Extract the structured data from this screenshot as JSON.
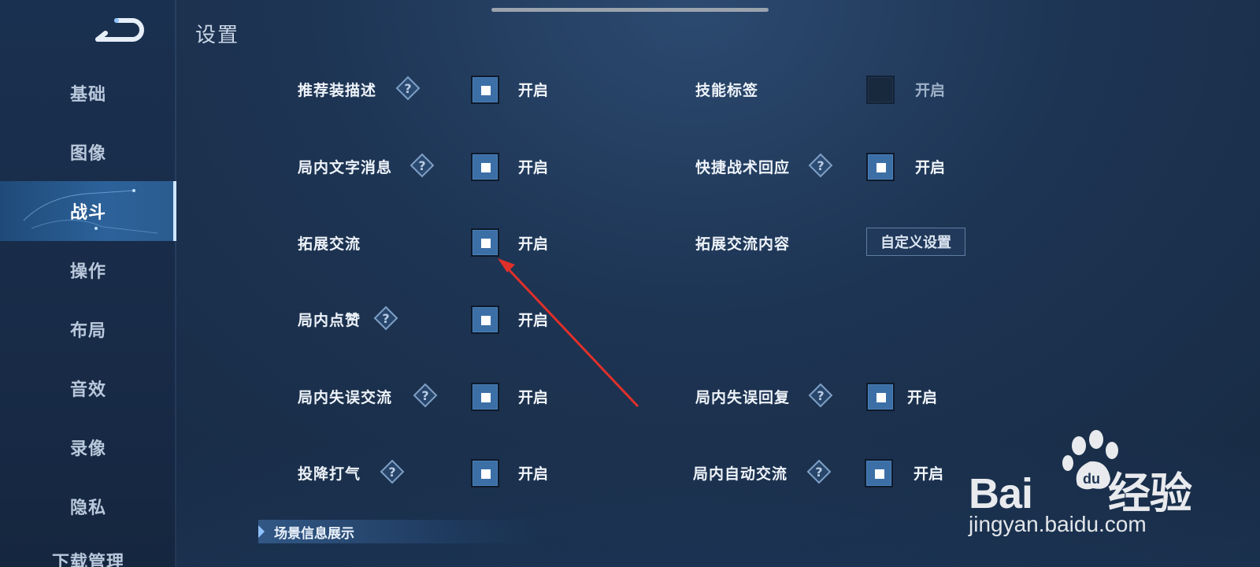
{
  "header": {
    "title": "设置"
  },
  "sidebar": {
    "items": [
      {
        "label": "基础"
      },
      {
        "label": "图像"
      },
      {
        "label": "战斗",
        "active": true
      },
      {
        "label": "操作"
      },
      {
        "label": "布局"
      },
      {
        "label": "音效"
      },
      {
        "label": "录像"
      },
      {
        "label": "隐私"
      },
      {
        "label": "下载管理"
      }
    ]
  },
  "settings": {
    "left": [
      {
        "label": "推荐装描述",
        "help": true,
        "checked": true,
        "state_text": "开启"
      },
      {
        "label": "局内文字消息",
        "help": true,
        "checked": true,
        "state_text": "开启"
      },
      {
        "label": "拓展交流",
        "help": false,
        "checked": true,
        "state_text": "开启"
      },
      {
        "label": "局内点赞",
        "help": true,
        "checked": true,
        "state_text": "开启"
      },
      {
        "label": "局内失误交流",
        "help": true,
        "checked": true,
        "state_text": "开启"
      },
      {
        "label": "投降打气",
        "help": true,
        "checked": true,
        "state_text": "开启"
      }
    ],
    "right": [
      {
        "label": "技能标签",
        "help": false,
        "checked": false,
        "state_text": "开启"
      },
      {
        "label": "快捷战术回应",
        "help": true,
        "checked": true,
        "state_text": "开启"
      },
      {
        "label": "拓展交流内容",
        "help": false,
        "button_label": "自定义设置"
      },
      {
        "label": "局内失误回复",
        "help": true,
        "checked": true,
        "state_text": "开启"
      },
      {
        "label": "局内自动交流",
        "help": true,
        "checked": true,
        "state_text": "开启"
      }
    ]
  },
  "section": {
    "label": "场景信息展示"
  },
  "watermark": {
    "logo_left": "Bai",
    "logo_right": "经验",
    "url": "jingyan.baidu.com"
  },
  "colors": {
    "checkbox_on": "#3c6fa6",
    "annotation_arrow": "#e0302a",
    "active_nav": "#2c629a"
  }
}
